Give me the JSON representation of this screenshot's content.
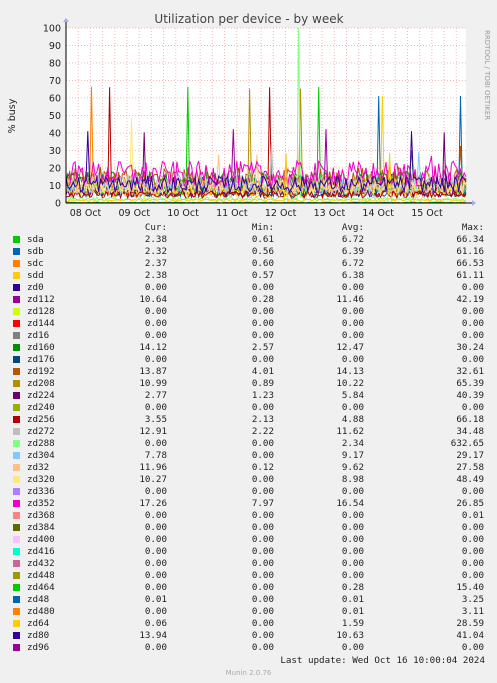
{
  "chart_data": {
    "type": "line",
    "title": "Utilization per device - by week",
    "ylabel": "% busy",
    "ylim": [
      0,
      100
    ],
    "yticks": [
      0,
      10,
      20,
      30,
      40,
      50,
      60,
      70,
      80,
      90,
      100
    ],
    "x_tick_labels": [
      "08 Oct",
      "09 Oct",
      "10 Oct",
      "11 Oct",
      "12 Oct",
      "13 Oct",
      "14 Oct",
      "15 Oct"
    ],
    "x_range_days": [
      0,
      8.2
    ],
    "x_tick_days": [
      0.4,
      1.4,
      2.4,
      3.4,
      4.4,
      5.4,
      6.4,
      7.4
    ],
    "side_label": "RRDTOOL / TOBI OETIKER",
    "grid": true,
    "columns": [
      "Cur:",
      "Min:",
      "Avg:",
      "Max:"
    ],
    "series": [
      {
        "name": "sda",
        "color": "#00cc00",
        "cur": "2.38",
        "min": "0.61",
        "avg": "6.72",
        "max": "66.34"
      },
      {
        "name": "sdb",
        "color": "#0066b3",
        "cur": "2.32",
        "min": "0.56",
        "avg": "6.39",
        "max": "61.16"
      },
      {
        "name": "sdc",
        "color": "#ff8000",
        "cur": "2.37",
        "min": "0.60",
        "avg": "6.72",
        "max": "66.53"
      },
      {
        "name": "sdd",
        "color": "#ffcc00",
        "cur": "2.38",
        "min": "0.57",
        "avg": "6.38",
        "max": "61.11"
      },
      {
        "name": "zd0",
        "color": "#330099",
        "cur": "0.00",
        "min": "0.00",
        "avg": "0.00",
        "max": "0.00"
      },
      {
        "name": "zd112",
        "color": "#990099",
        "cur": "10.64",
        "min": "0.28",
        "avg": "11.46",
        "max": "42.19"
      },
      {
        "name": "zd128",
        "color": "#ccff00",
        "cur": "0.00",
        "min": "0.00",
        "avg": "0.00",
        "max": "0.00"
      },
      {
        "name": "zd144",
        "color": "#ff0000",
        "cur": "0.00",
        "min": "0.00",
        "avg": "0.00",
        "max": "0.00"
      },
      {
        "name": "zd16",
        "color": "#808080",
        "cur": "0.00",
        "min": "0.00",
        "avg": "0.00",
        "max": "0.00"
      },
      {
        "name": "zd160",
        "color": "#008f00",
        "cur": "14.12",
        "min": "2.57",
        "avg": "12.47",
        "max": "30.24"
      },
      {
        "name": "zd176",
        "color": "#00487d",
        "cur": "0.00",
        "min": "0.00",
        "avg": "0.00",
        "max": "0.00"
      },
      {
        "name": "zd192",
        "color": "#b35a00",
        "cur": "13.87",
        "min": "4.01",
        "avg": "14.13",
        "max": "32.61"
      },
      {
        "name": "zd208",
        "color": "#b38f00",
        "cur": "10.99",
        "min": "0.89",
        "avg": "10.22",
        "max": "65.39"
      },
      {
        "name": "zd224",
        "color": "#6b006b",
        "cur": "2.77",
        "min": "1.23",
        "avg": "5.84",
        "max": "40.39"
      },
      {
        "name": "zd240",
        "color": "#8fb300",
        "cur": "0.00",
        "min": "0.00",
        "avg": "0.00",
        "max": "0.00"
      },
      {
        "name": "zd256",
        "color": "#b30000",
        "cur": "3.55",
        "min": "2.13",
        "avg": "4.88",
        "max": "66.18"
      },
      {
        "name": "zd272",
        "color": "#bebebe",
        "cur": "12.91",
        "min": "2.22",
        "avg": "11.62",
        "max": "34.48"
      },
      {
        "name": "zd288",
        "color": "#80ff80",
        "cur": "0.00",
        "min": "0.00",
        "avg": "2.34",
        "max": "632.65"
      },
      {
        "name": "zd304",
        "color": "#80c9ff",
        "cur": "7.78",
        "min": "0.00",
        "avg": "9.17",
        "max": "29.17"
      },
      {
        "name": "zd32",
        "color": "#ffc080",
        "cur": "11.96",
        "min": "0.12",
        "avg": "9.62",
        "max": "27.58"
      },
      {
        "name": "zd320",
        "color": "#ffe680",
        "cur": "10.27",
        "min": "0.00",
        "avg": "8.98",
        "max": "48.49"
      },
      {
        "name": "zd336",
        "color": "#aa80ff",
        "cur": "0.00",
        "min": "0.00",
        "avg": "0.00",
        "max": "0.00"
      },
      {
        "name": "zd352",
        "color": "#ee00cc",
        "cur": "17.26",
        "min": "7.97",
        "avg": "16.54",
        "max": "26.85"
      },
      {
        "name": "zd368",
        "color": "#ff8080",
        "cur": "0.00",
        "min": "0.00",
        "avg": "0.00",
        "max": "0.01"
      },
      {
        "name": "zd384",
        "color": "#666600",
        "cur": "0.00",
        "min": "0.00",
        "avg": "0.00",
        "max": "0.00"
      },
      {
        "name": "zd400",
        "color": "#ffbfff",
        "cur": "0.00",
        "min": "0.00",
        "avg": "0.00",
        "max": "0.00"
      },
      {
        "name": "zd416",
        "color": "#00ffcc",
        "cur": "0.00",
        "min": "0.00",
        "avg": "0.00",
        "max": "0.00"
      },
      {
        "name": "zd432",
        "color": "#cc6699",
        "cur": "0.00",
        "min": "0.00",
        "avg": "0.00",
        "max": "0.00"
      },
      {
        "name": "zd448",
        "color": "#999900",
        "cur": "0.00",
        "min": "0.00",
        "avg": "0.00",
        "max": "0.00"
      },
      {
        "name": "zd464",
        "color": "#00cc00",
        "cur": "0.00",
        "min": "0.00",
        "avg": "0.28",
        "max": "15.40"
      },
      {
        "name": "zd48",
        "color": "#0066b3",
        "cur": "0.01",
        "min": "0.00",
        "avg": "0.01",
        "max": "3.25"
      },
      {
        "name": "zd480",
        "color": "#ff8000",
        "cur": "0.00",
        "min": "0.00",
        "avg": "0.01",
        "max": "3.11"
      },
      {
        "name": "zd64",
        "color": "#ffcc00",
        "cur": "0.06",
        "min": "0.00",
        "avg": "1.59",
        "max": "28.59"
      },
      {
        "name": "zd80",
        "color": "#330099",
        "cur": "13.94",
        "min": "0.00",
        "avg": "10.63",
        "max": "41.04"
      },
      {
        "name": "zd96",
        "color": "#990099",
        "cur": "0.00",
        "min": "0.00",
        "avg": "0.00",
        "max": "0.00"
      }
    ]
  },
  "last_update": "Last update: Wed Oct 16 10:00:04 2024",
  "footer": "Munin 2.0.76"
}
